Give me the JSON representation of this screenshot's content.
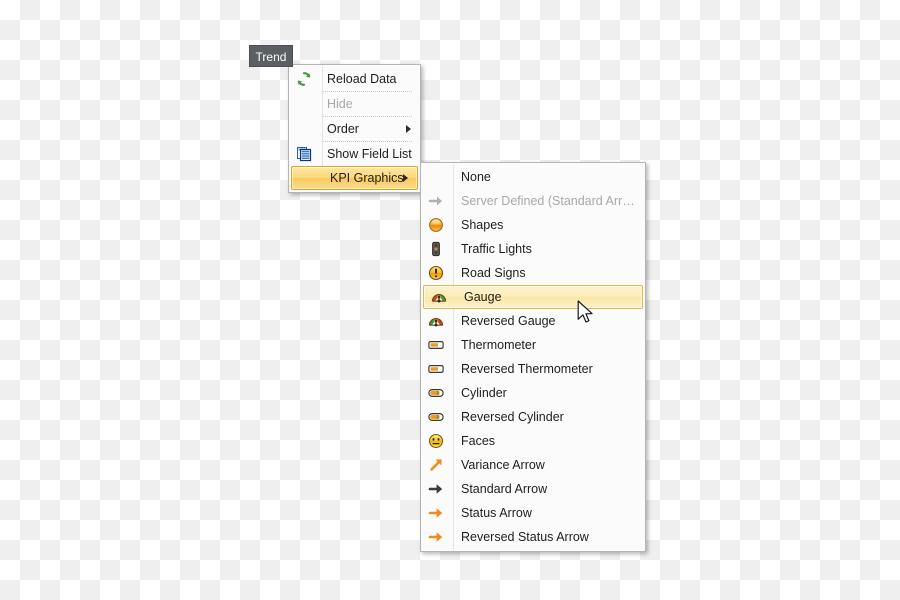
{
  "tooltip": {
    "label": "Trend"
  },
  "context_menu": {
    "items": [
      {
        "label": "Reload Data",
        "icon": "refresh-icon",
        "state": "normal",
        "submenu": false
      },
      {
        "label": "Hide",
        "icon": "none",
        "state": "disabled",
        "submenu": false
      },
      {
        "label": "Order",
        "icon": "none",
        "state": "normal",
        "submenu": true
      },
      {
        "label": "Show Field List",
        "icon": "field-list-icon",
        "state": "normal",
        "submenu": false
      },
      {
        "label": "KPI Graphics",
        "icon": "none",
        "state": "highlighted",
        "submenu": true
      }
    ]
  },
  "kpi_submenu": {
    "items": [
      {
        "label": "None",
        "icon": "none",
        "state": "normal"
      },
      {
        "label": "Server Defined (Standard Arrow)",
        "icon": "gray-arrow-icon",
        "state": "disabled"
      },
      {
        "label": "Shapes",
        "icon": "orange-circle-icon",
        "state": "normal"
      },
      {
        "label": "Traffic Lights",
        "icon": "traffic-light-icon",
        "state": "normal"
      },
      {
        "label": "Road Signs",
        "icon": "road-sign-icon",
        "state": "normal"
      },
      {
        "label": "Gauge",
        "icon": "gauge-icon",
        "state": "highlighted"
      },
      {
        "label": "Reversed Gauge",
        "icon": "gauge-icon",
        "state": "normal"
      },
      {
        "label": "Thermometer",
        "icon": "thermometer-icon",
        "state": "normal"
      },
      {
        "label": "Reversed Thermometer",
        "icon": "thermometer-icon",
        "state": "normal"
      },
      {
        "label": "Cylinder",
        "icon": "cylinder-icon",
        "state": "normal"
      },
      {
        "label": "Reversed Cylinder",
        "icon": "cylinder-icon",
        "state": "normal"
      },
      {
        "label": "Faces",
        "icon": "face-icon",
        "state": "normal"
      },
      {
        "label": "Variance Arrow",
        "icon": "variance-arrow-icon",
        "state": "normal"
      },
      {
        "label": "Standard Arrow",
        "icon": "standard-arrow-icon",
        "state": "normal"
      },
      {
        "label": "Status Arrow",
        "icon": "status-arrow-icon",
        "state": "normal"
      },
      {
        "label": "Reversed Status Arrow",
        "icon": "status-arrow-icon",
        "state": "normal"
      }
    ]
  },
  "colors": {
    "highlight_gold": "#f9c95c",
    "highlight_gold_border": "#e0a22b",
    "highlight_soft": "#fcedb8",
    "menu_background": "#fbfbfb",
    "menu_border": "#b4b4b4",
    "tooltip_background": "#5b5f63",
    "accent_orange": "#f08a1b",
    "disabled_text": "#a8a8a8"
  }
}
